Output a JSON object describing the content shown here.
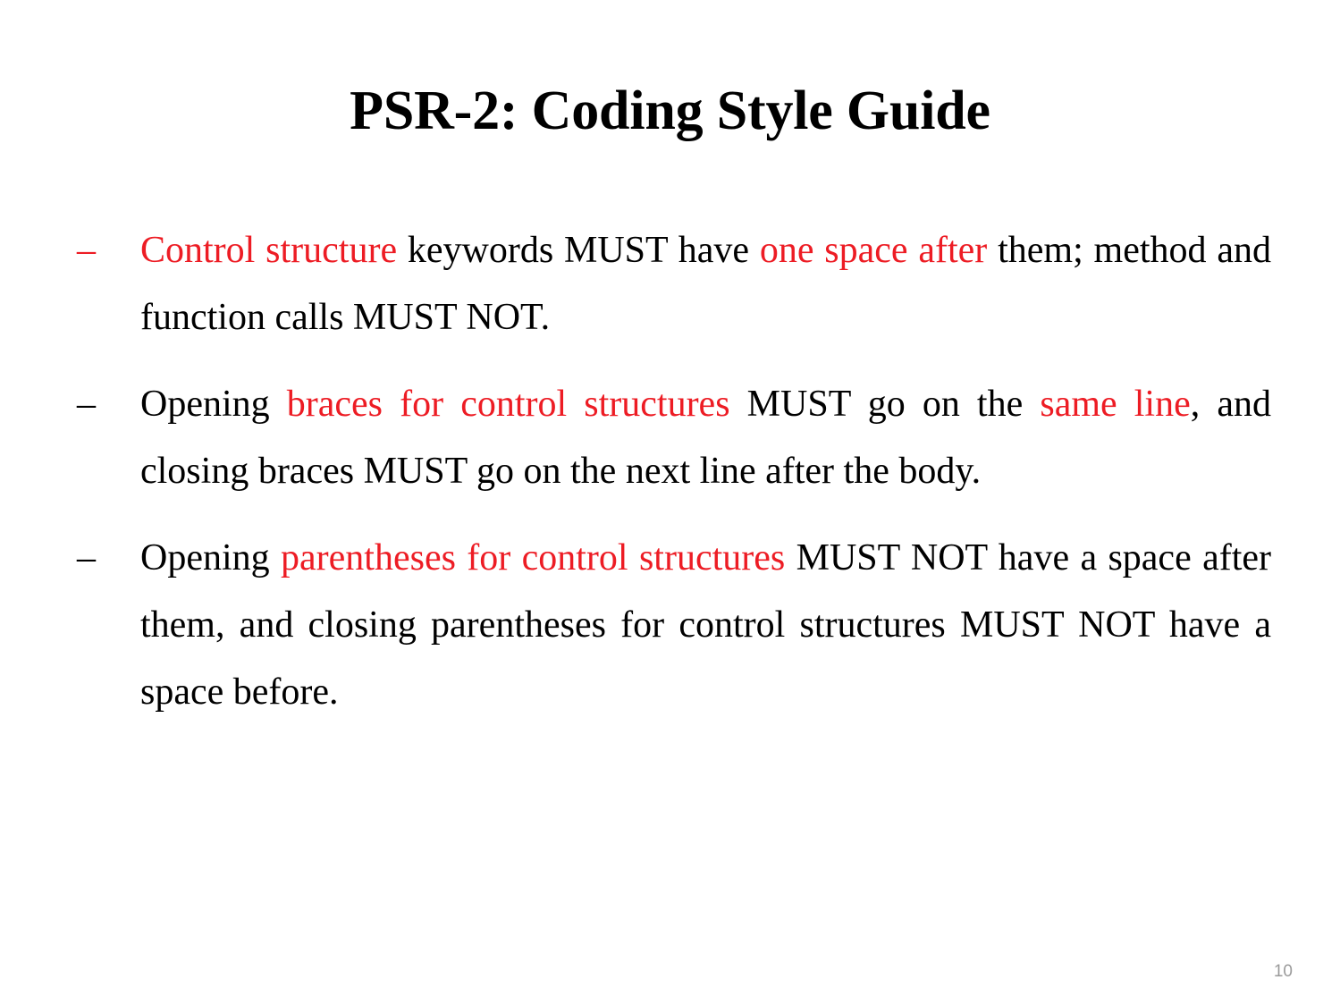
{
  "slide": {
    "title": "PSR-2: Coding Style Guide",
    "page_number": "10",
    "background_color": "#FFFFFF",
    "highlight_color": "#ED1C24",
    "text_color": "#000000",
    "page_number_color": "#9A9A9A",
    "bullet_marker": "–"
  },
  "bullets": [
    {
      "marker": "–",
      "marker_color": "#ED1C24",
      "segments": [
        {
          "text": "Control structure",
          "highlight": true
        },
        {
          "text": " keywords MUST have ",
          "highlight": false
        },
        {
          "text": "one space after",
          "highlight": true
        },
        {
          "text": " them; method and function calls MUST NOT.",
          "highlight": false
        }
      ],
      "plain_text": "Control structure keywords MUST have one space after them; method and function calls MUST NOT."
    },
    {
      "marker": "–",
      "marker_color": "#000000",
      "segments": [
        {
          "text": "Opening ",
          "highlight": false
        },
        {
          "text": "braces for control structures",
          "highlight": true
        },
        {
          "text": " MUST go on the ",
          "highlight": false
        },
        {
          "text": "same line",
          "highlight": true
        },
        {
          "text": ", and closing braces MUST go on the next line after the body.",
          "highlight": false
        }
      ],
      "plain_text": "Opening braces for control structures MUST go on the same line, and closing braces MUST go on the next line after the body."
    },
    {
      "marker": "–",
      "marker_color": "#000000",
      "segments": [
        {
          "text": "Opening ",
          "highlight": false
        },
        {
          "text": "parentheses for control structures",
          "highlight": true
        },
        {
          "text": " MUST NOT have a space after them, and closing parentheses for control structures MUST NOT have a space before.",
          "highlight": false
        }
      ],
      "plain_text": "Opening parentheses for control structures MUST NOT have a space after them, and closing parentheses for control structures MUST NOT have a space before."
    }
  ]
}
